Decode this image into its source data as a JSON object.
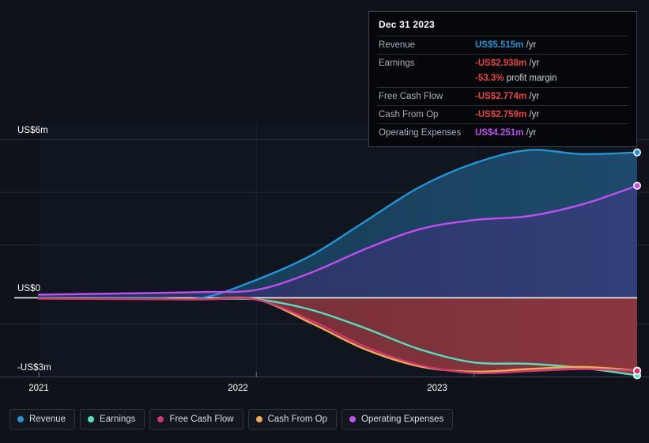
{
  "chart_data": {
    "type": "area",
    "title": "",
    "xlabel": "",
    "ylabel": "",
    "ylim": [
      -3,
      6
    ],
    "xlim": [
      "2021",
      "2023.75"
    ],
    "grid": true,
    "legend_position": "bottom",
    "x_ticks": [
      "2021",
      "2022",
      "2023"
    ],
    "y_ticks": [
      "US$6m",
      "US$0",
      "-US$3m"
    ],
    "currency": "US$",
    "series": [
      {
        "name": "Revenue",
        "color": "#2196d6",
        "x": [
          2021.0,
          2021.25,
          2021.5,
          2021.75,
          2022.0,
          2022.25,
          2022.5,
          2022.75,
          2023.0,
          2023.25,
          2023.5,
          2023.75
        ],
        "values": [
          0.0,
          0.0,
          0.0,
          0.0,
          0.68,
          1.6,
          2.9,
          4.2,
          5.1,
          5.6,
          5.45,
          5.515
        ]
      },
      {
        "name": "Earnings",
        "color": "#4fe3c2",
        "x": [
          2021.0,
          2021.25,
          2021.5,
          2021.75,
          2022.0,
          2022.25,
          2022.5,
          2022.75,
          2023.0,
          2023.25,
          2023.5,
          2023.75
        ],
        "values": [
          -0.02,
          -0.03,
          -0.04,
          -0.05,
          -0.06,
          -0.45,
          -1.15,
          -1.95,
          -2.45,
          -2.5,
          -2.66,
          -2.938
        ]
      },
      {
        "name": "Free Cash Flow",
        "color": "#d6356f",
        "x": [
          2021.0,
          2021.25,
          2021.5,
          2021.75,
          2022.0,
          2022.25,
          2022.5,
          2022.75,
          2023.0,
          2023.25,
          2023.5,
          2023.75
        ],
        "values": [
          -0.03,
          -0.04,
          -0.05,
          -0.06,
          -0.07,
          -0.85,
          -1.85,
          -2.55,
          -2.85,
          -2.78,
          -2.7,
          -2.774
        ]
      },
      {
        "name": "Cash From Op",
        "color": "#efab54",
        "x": [
          2021.0,
          2021.25,
          2021.5,
          2021.75,
          2022.0,
          2022.25,
          2022.5,
          2022.75,
          2023.0,
          2023.25,
          2023.5,
          2023.75
        ],
        "values": [
          -0.02,
          -0.03,
          -0.04,
          -0.05,
          -0.06,
          -0.95,
          -1.95,
          -2.6,
          -2.8,
          -2.7,
          -2.62,
          -2.759
        ]
      },
      {
        "name": "Operating Expenses",
        "color": "#c04ef0",
        "x": [
          2021.0,
          2021.25,
          2021.5,
          2021.75,
          2022.0,
          2022.25,
          2022.5,
          2022.75,
          2023.0,
          2023.25,
          2023.5,
          2023.75
        ],
        "values": [
          0.12,
          0.15,
          0.18,
          0.22,
          0.3,
          0.95,
          1.85,
          2.6,
          2.95,
          3.1,
          3.55,
          4.251
        ]
      }
    ]
  },
  "axis": {
    "y_top_label": "US$6m",
    "y_zero_label": "US$0",
    "y_bottom_label": "-US$3m",
    "x_labels": [
      "2021",
      "2022",
      "2023"
    ]
  },
  "tooltip": {
    "date": "Dec 31 2023",
    "rows": [
      {
        "key": "Revenue",
        "value": "US$5.515m",
        "unit": "/yr",
        "color": "#2196d6"
      },
      {
        "key": "Earnings",
        "value": "-US$2.938m",
        "unit": "/yr",
        "color": "#e8433f"
      },
      {
        "key": "",
        "value": "-53.3%",
        "unit": "profit margin",
        "color": "#e8433f"
      },
      {
        "key": "Free Cash Flow",
        "value": "-US$2.774m",
        "unit": "/yr",
        "color": "#e8433f"
      },
      {
        "key": "Cash From Op",
        "value": "-US$2.759m",
        "unit": "/yr",
        "color": "#e8433f"
      },
      {
        "key": "Operating Expenses",
        "value": "US$4.251m",
        "unit": "/yr",
        "color": "#c04ef0"
      }
    ]
  },
  "legend": {
    "items": [
      {
        "label": "Revenue",
        "color": "#2196d6"
      },
      {
        "label": "Earnings",
        "color": "#4fe3c2"
      },
      {
        "label": "Free Cash Flow",
        "color": "#d6356f"
      },
      {
        "label": "Cash From Op",
        "color": "#efab54"
      },
      {
        "label": "Operating Expenses",
        "color": "#c04ef0"
      }
    ]
  },
  "colors": {
    "background": "#0f1319",
    "plot_background": "#101620",
    "positive_fill_revenue": "#1b4160",
    "positive_fill_opex": "#2c3569",
    "negative_fill": "#7a3038",
    "gridline": "#252b35",
    "axis_line": "#ffffff"
  }
}
